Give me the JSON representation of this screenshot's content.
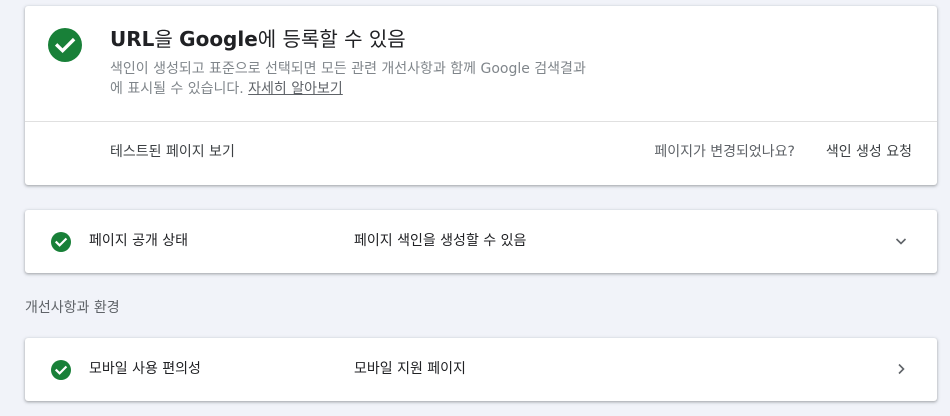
{
  "colors": {
    "success_green": "#188038",
    "background": "#f1f3f9",
    "card": "#ffffff"
  },
  "main_card": {
    "icon": "check-circle-icon",
    "title_part1": "URL",
    "title_part2": "을 ",
    "title_part3": "Google",
    "title_part4": "에 등록할 수 있음",
    "description_line1": "색인이 생성되고 표준으로 선택되면 모든 관련 개선사항과 함께 Google 검색결과",
    "description_line2": "에 표시될 수 있습니다. ",
    "learn_more": "자세히 알아보기",
    "view_tested_page": "테스트된 페이지 보기",
    "page_changed_question": "페이지가 변경되었나요?",
    "request_indexing": "색인 생성 요청"
  },
  "availability_row": {
    "icon": "check-circle-icon",
    "label": "페이지 공개 상태",
    "value": "페이지 색인을 생성할 수 있음",
    "chevron": "chevron-down-icon"
  },
  "enhancements_section": {
    "heading": "개선사항과 환경"
  },
  "mobile_row": {
    "icon": "check-circle-icon",
    "label": "모바일 사용 편의성",
    "value": "모바일 지원 페이지",
    "chevron": "chevron-right-icon"
  }
}
